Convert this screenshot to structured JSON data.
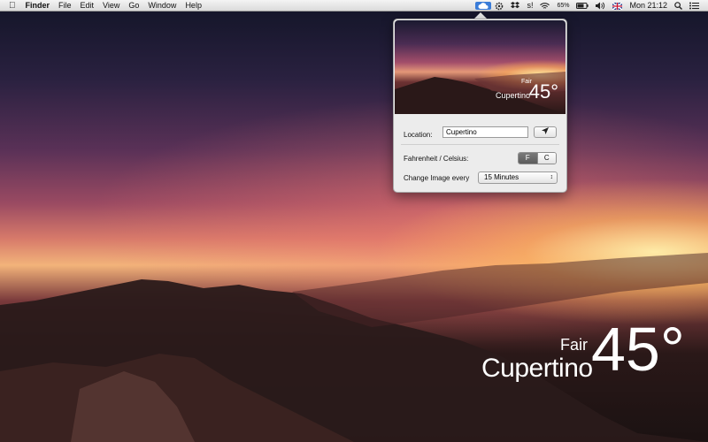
{
  "menubar": {
    "app_name": "Finder",
    "menus": [
      "File",
      "Edit",
      "View",
      "Go",
      "Window",
      "Help"
    ],
    "status": {
      "sync_label": "s!",
      "battery_percent": "65%",
      "clock": "Mon 21:12"
    }
  },
  "popover": {
    "thumbnail": {
      "condition": "Fair",
      "city": "Cupertino",
      "temperature": "45°"
    },
    "location_label": "Location:",
    "location_value": "Cupertino",
    "units_label": "Fahrenheit / Celsius:",
    "units_options": [
      "F",
      "C"
    ],
    "units_selected": "F",
    "image_label": "Change Image every",
    "image_interval": "15 Minutes"
  },
  "desktop_widget": {
    "condition": "Fair",
    "city": "Cupertino",
    "temperature": "45°"
  },
  "colors": {
    "menubar_bg": "#e6e6e6",
    "selected_status_bg": "#3a7cd8",
    "popover_bg": "#ececec",
    "segment_on": "#666666"
  },
  "icons": [
    "apple-icon",
    "cloud-icon",
    "gear-icon",
    "dropbox-icon",
    "wifi-icon",
    "volume-icon",
    "battery-icon",
    "search-icon",
    "list-icon",
    "location-arrow-icon",
    "chevron-updown-icon"
  ]
}
